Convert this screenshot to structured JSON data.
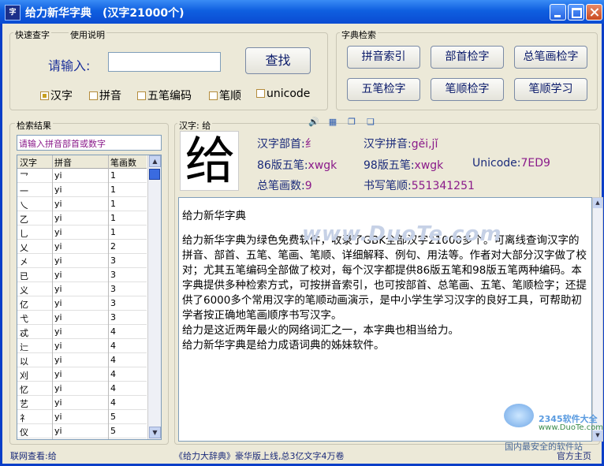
{
  "window": {
    "title": "给力新华字典",
    "subtitle": "(汉字21000个)",
    "app_icon": "字"
  },
  "search_panel": {
    "tabs": [
      "快速查字",
      "使用说明"
    ],
    "prompt": "请输入:",
    "input_value": "",
    "search_button": "查找",
    "modes": [
      {
        "label": "汉字",
        "checked": true
      },
      {
        "label": "拼音",
        "checked": false
      },
      {
        "label": "五笔编码",
        "checked": false
      },
      {
        "label": "笔顺",
        "checked": false
      },
      {
        "label": "unicode",
        "checked": false
      }
    ]
  },
  "dict_search": {
    "title": "字典检索",
    "buttons": [
      "拼音索引",
      "部首检字",
      "总笔画检字",
      "五笔检字",
      "笔顺检字",
      "笔顺学习"
    ]
  },
  "results": {
    "title": "检索结果",
    "hint": "请输入拼音部首或数字",
    "columns": [
      "汉字",
      "拼音",
      "笔画数"
    ],
    "rows": [
      [
        "乛",
        "yi",
        "1"
      ],
      [
        "一",
        "yi",
        "1"
      ],
      [
        "乀",
        "yi",
        "1"
      ],
      [
        "乙",
        "yi",
        "1"
      ],
      [
        "乚",
        "yi",
        "1"
      ],
      [
        "乂",
        "yi",
        "2"
      ],
      [
        "㐅",
        "yi",
        "3"
      ],
      [
        "已",
        "yi",
        "3"
      ],
      [
        "义",
        "yi",
        "3"
      ],
      [
        "亿",
        "yi",
        "3"
      ],
      [
        "弋",
        "yi",
        "3"
      ],
      [
        "忒",
        "yi",
        "4"
      ],
      [
        "辷",
        "yi",
        "4"
      ],
      [
        "以",
        "yi",
        "4"
      ],
      [
        "刈",
        "yi",
        "4"
      ],
      [
        "忆",
        "yi",
        "4"
      ],
      [
        "艺",
        "yi",
        "4"
      ],
      [
        "礻",
        "yi",
        "5"
      ],
      [
        "仪",
        "yi",
        "5"
      ]
    ]
  },
  "detail": {
    "header": "汉字: 给",
    "char": "给",
    "radical_label": "汉字部首:",
    "radical_value": "纟",
    "pinyin_label": "汉字拼音:",
    "pinyin_value": "gěi,jǐ",
    "wubi86_label": "86版五笔:",
    "wubi86_value": "xwgk",
    "wubi98_label": "98版五笔:",
    "wubi98_value": "xwgk",
    "unicode_label": "Unicode:",
    "unicode_value": "7ED9",
    "strokes_label": "总笔画数:",
    "strokes_value": "9",
    "order_label": "书写笔顺:",
    "order_value": "551341251",
    "tool_icons": [
      "speaker-icon",
      "image-icon",
      "copy-icon",
      "paste-icon"
    ]
  },
  "description": {
    "heading": "给力新华字典",
    "paragraphs": [
      "给力新华字典为绿色免费软件，收录了GBK全部汉字21000多个。可离线查询汉字的拼音、部首、五笔、笔画、笔顺、详细解释、例句、用法等。作者对大部分汉字做了校对；尤其五笔编码全部做了校对，每个汉字都提供86版五笔和98版五笔两种编码。本字典提供多种检索方式，可按拼音索引，也可按部首、总笔画、五笔、笔顺检字；还提供了6000多个常用汉字的笔顺动画演示，是中小学生学习汉字的良好工具，可帮助初学者按正确地笔画顺序书写汉字。",
      "给力是这近两年最火的网络词汇之一，本字典也相当给力。",
      "给力新华字典是给力成语词典的姊妹软件。"
    ]
  },
  "watermarks": {
    "center": "www.DuoTe.com",
    "corner": "2345软件大全",
    "corner_url": "www.DuoTe.com",
    "corner_slogan": "国内最安全的软件站"
  },
  "status": {
    "left": "联网查看:给",
    "center": "《给力大辞典》豪华版上线,总3亿文字4万卷",
    "right": "官方主页"
  }
}
